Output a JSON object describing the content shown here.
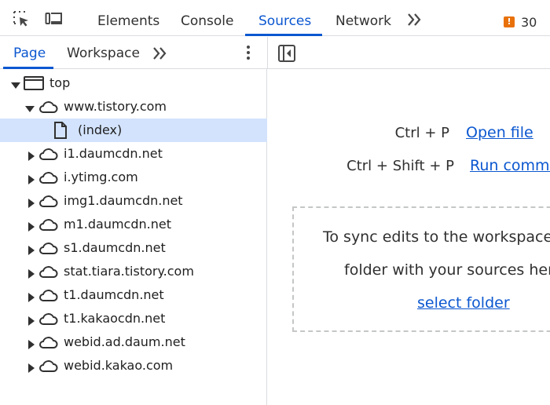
{
  "toolbar": {
    "tabs": [
      {
        "label": "Elements"
      },
      {
        "label": "Console"
      },
      {
        "label": "Sources"
      },
      {
        "label": "Network"
      }
    ],
    "issues_count": "30",
    "issues_badge_glyph": "!"
  },
  "navigator": {
    "tabs": [
      {
        "label": "Page"
      },
      {
        "label": "Workspace"
      }
    ],
    "tree": [
      {
        "label": "top",
        "type": "frame",
        "expanded": true,
        "level": 0
      },
      {
        "label": "www.tistory.com",
        "type": "domain",
        "expanded": true,
        "level": 1
      },
      {
        "label": "(index)",
        "type": "file",
        "level": 2,
        "selected": true
      },
      {
        "label": "i1.daumcdn.net",
        "type": "domain",
        "expanded": false,
        "level": 1
      },
      {
        "label": "i.ytimg.com",
        "type": "domain",
        "expanded": false,
        "level": 1
      },
      {
        "label": "img1.daumcdn.net",
        "type": "domain",
        "expanded": false,
        "level": 1
      },
      {
        "label": "m1.daumcdn.net",
        "type": "domain",
        "expanded": false,
        "level": 1
      },
      {
        "label": "s1.daumcdn.net",
        "type": "domain",
        "expanded": false,
        "level": 1
      },
      {
        "label": "stat.tiara.tistory.com",
        "type": "domain",
        "expanded": false,
        "level": 1
      },
      {
        "label": "t1.daumcdn.net",
        "type": "domain",
        "expanded": false,
        "level": 1
      },
      {
        "label": "t1.kakaocdn.net",
        "type": "domain",
        "expanded": false,
        "level": 1
      },
      {
        "label": "webid.ad.daum.net",
        "type": "domain",
        "expanded": false,
        "level": 1
      },
      {
        "label": "webid.kakao.com",
        "type": "domain",
        "expanded": false,
        "level": 1
      }
    ]
  },
  "editor": {
    "shortcuts": [
      {
        "keys": "Ctrl + P",
        "action": "Open file"
      },
      {
        "keys": "Ctrl + Shift + P",
        "action": "Run comma"
      }
    ],
    "drop_zone": {
      "line1": "To sync edits to the workspace,",
      "line2": "folder with your sources here",
      "link": "select folder"
    }
  },
  "colors": {
    "accent": "#0b57d0",
    "selection": "#d3e3fd",
    "issue_badge": "#e8710a"
  }
}
